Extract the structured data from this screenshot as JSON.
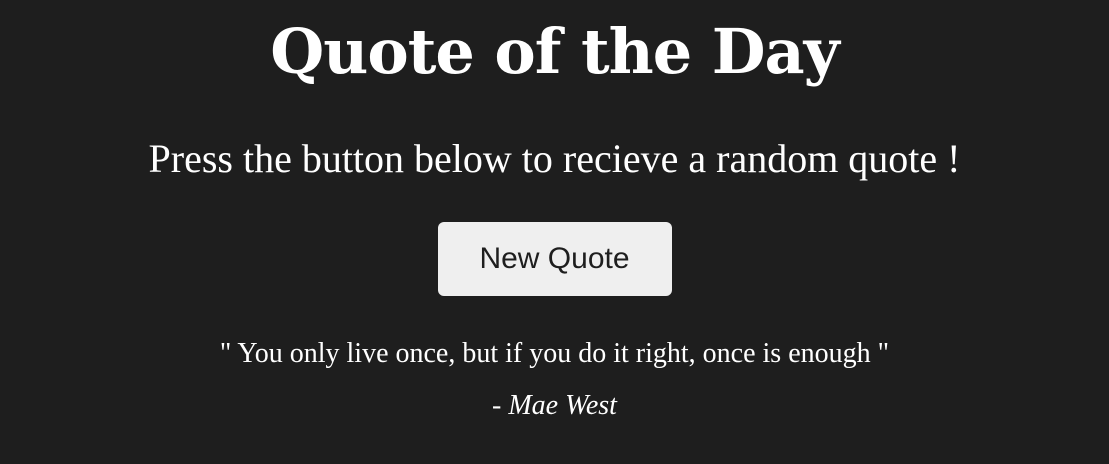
{
  "header": {
    "title": "Quote of the Day",
    "subtitle": "Press the button below to recieve a random quote !"
  },
  "controls": {
    "new_quote_label": "New Quote"
  },
  "quote": {
    "text": "\" You only live once, but if you do it right, once is enough \"",
    "author": "- Mae West"
  },
  "colors": {
    "background": "#1e1e1e",
    "text": "#ffffff",
    "button_background": "#efefef",
    "button_text": "#1e1e1e"
  }
}
